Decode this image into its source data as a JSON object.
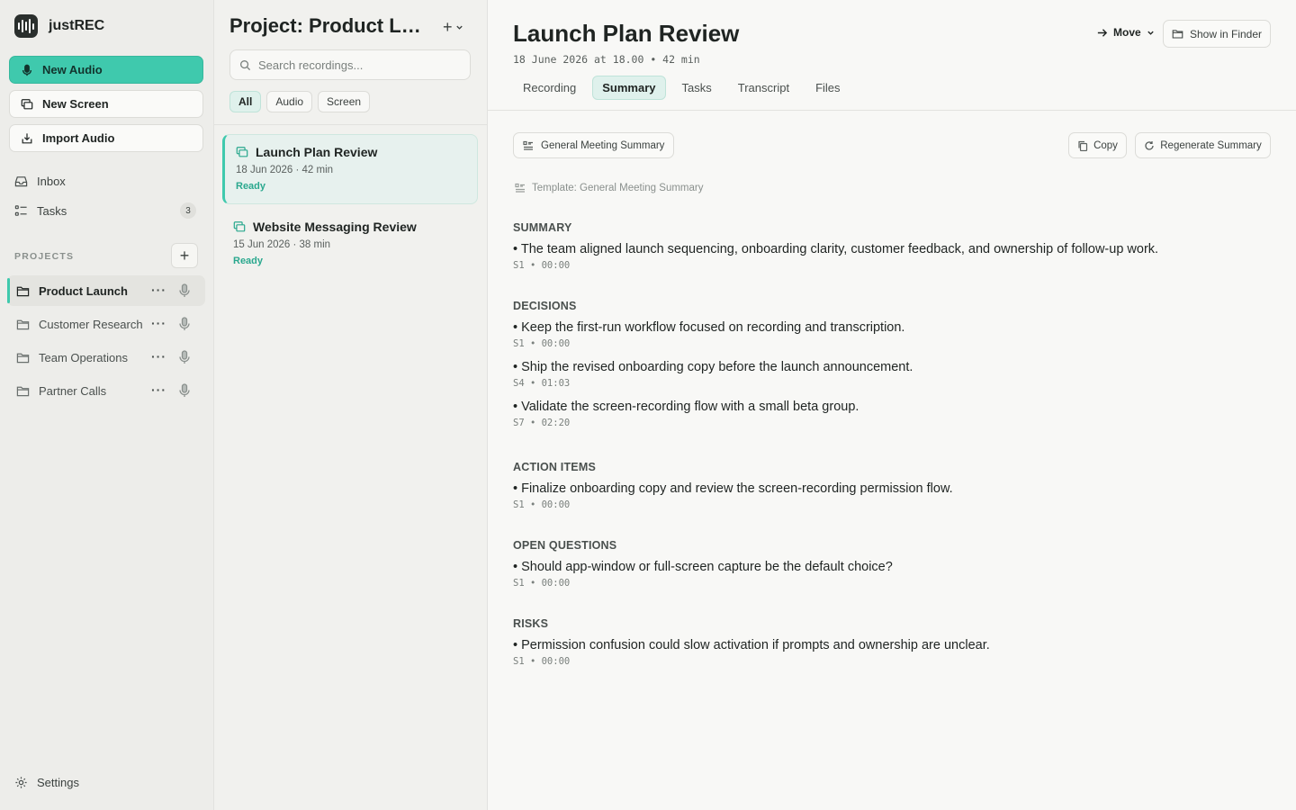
{
  "app": {
    "name": "justREC"
  },
  "sidebar": {
    "new_audio": "New Audio",
    "new_screen": "New Screen",
    "import_audio": "Import Audio",
    "inbox": "Inbox",
    "tasks": "Tasks",
    "tasks_count": "3",
    "projects_label": "PROJECTS",
    "projects": [
      {
        "name": "Product Launch",
        "active": true
      },
      {
        "name": "Customer Research",
        "active": false
      },
      {
        "name": "Team Operations",
        "active": false
      },
      {
        "name": "Partner Calls",
        "active": false
      }
    ],
    "settings": "Settings",
    "accent": "#3fc9ad"
  },
  "list": {
    "title": "Project: Product Launch",
    "search_placeholder": "Search recordings...",
    "filters": [
      "All",
      "Audio",
      "Screen"
    ],
    "active_filter": "All",
    "recordings": [
      {
        "title": "Launch Plan Review",
        "meta": "18 Jun 2026 · 42 min",
        "status": "Ready"
      },
      {
        "title": "Website Messaging Review",
        "meta": "15 Jun 2026 · 38 min",
        "status": "Ready"
      }
    ]
  },
  "main": {
    "title": "Launch Plan Review",
    "meta": "18 June 2026 at 18.00 • 42 min",
    "move": "Move",
    "show_in_finder": "Show in Finder",
    "tabs": [
      "Recording",
      "Summary",
      "Tasks",
      "Transcript",
      "Files"
    ],
    "active_tab": "Summary",
    "template_button": "General Meeting Summary",
    "copy": "Copy",
    "regenerate": "Regenerate Summary",
    "template_line": "Template: General Meeting Summary",
    "sections": [
      {
        "heading": "SUMMARY",
        "items": [
          {
            "text": "• The team aligned launch sequencing, onboarding clarity, customer feedback, and ownership of follow-up work.",
            "stamp": "S1 • 00:00"
          }
        ]
      },
      {
        "heading": "DECISIONS",
        "items": [
          {
            "text": "• Keep the first-run workflow focused on recording and transcription.",
            "stamp": "S1 • 00:00"
          },
          {
            "text": "• Ship the revised onboarding copy before the launch announcement.",
            "stamp": "S4 • 01:03"
          },
          {
            "text": "• Validate the screen-recording flow with a small beta group.",
            "stamp": "S7 • 02:20"
          }
        ]
      },
      {
        "heading": "ACTION ITEMS",
        "items": [
          {
            "text": "• Finalize onboarding copy and review the screen-recording permission flow.",
            "stamp": "S1 • 00:00"
          }
        ]
      },
      {
        "heading": "OPEN QUESTIONS",
        "items": [
          {
            "text": "• Should app-window or full-screen capture be the default choice?",
            "stamp": "S1 • 00:00"
          }
        ]
      },
      {
        "heading": "RISKS",
        "items": [
          {
            "text": "• Permission confusion could slow activation if prompts and ownership are unclear.",
            "stamp": "S1 • 00:00"
          }
        ]
      }
    ]
  }
}
